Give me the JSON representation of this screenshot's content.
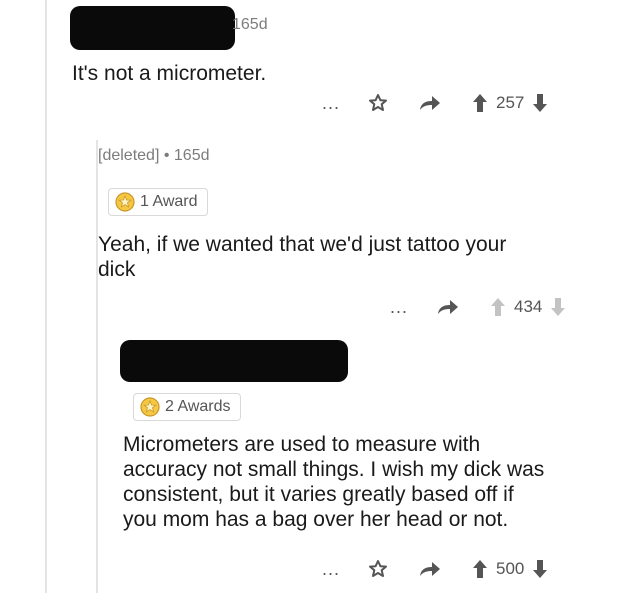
{
  "comments": [
    {
      "age": "165d",
      "body_lines": [
        "It's not a micrometer."
      ],
      "more": "...",
      "score": "257"
    },
    {
      "author": "[deleted]",
      "separator": "•",
      "age": "165d",
      "award": "1 Award",
      "body_lines": [
        "Yeah, if we wanted that we'd just tattoo your",
        "dick"
      ],
      "more": "...",
      "score": "434"
    },
    {
      "award": "2 Awards",
      "body_lines": [
        "Micrometers are used to measure with",
        "accuracy not small things.  I wish my dick was",
        "consistent, but it varies greatly based off if",
        "you mom has a bag over her head or not."
      ],
      "more": "...",
      "score": "500"
    }
  ],
  "colors": {
    "text": "#1a1a1b",
    "meta": "#7c7c7c",
    "thread_line": "#e4e4e4",
    "redaction": "#0a0a0a"
  },
  "icons": [
    "gift-icon",
    "share-icon",
    "upvote-icon",
    "downvote-icon",
    "medal-icon"
  ]
}
